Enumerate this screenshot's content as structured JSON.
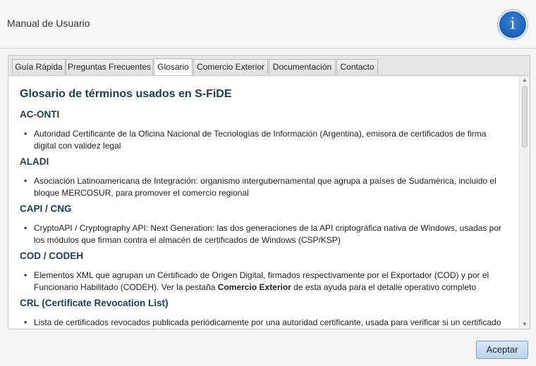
{
  "window": {
    "title": "Manual de Usuario",
    "info_icon": "i"
  },
  "tabs": [
    {
      "label": "Guía Rápida"
    },
    {
      "label": "Preguntas Frecuentes"
    },
    {
      "label": "Glosario",
      "active": true
    },
    {
      "label": "Comercio Exterior"
    },
    {
      "label": "Documentación"
    },
    {
      "label": "Contacto"
    }
  ],
  "glossary": {
    "title": "Glosario de términos usados en S-FiDE",
    "bullet": "•",
    "entries": [
      {
        "term": "AC-ONTI",
        "definition": "Autoridad Certificante de la Oficina Nacional de Tecnologías de Información (Argentina), emisora de certificados de firma digital con validez legal"
      },
      {
        "term": "ALADI",
        "definition": "Asociación Latinoamericana de Integración: organismo intergubernamental que agrupa a países de Sudamérica, incluido el bloque MERCOSUR, para promover el comercio regional"
      },
      {
        "term": "CAPI / CNG",
        "definition": "CryptoAPI / Cryptography API: Next Generation: las dos generaciones de la API criptográfica nativa de Windows, usadas por los módulos que firman contra el almacén de certificados de Windows (CSP/KSP)"
      },
      {
        "term": "COD / CODEH",
        "definition_parts": [
          "Elementos XML que agrupan un Certificado de Origen Digital, firmados respectivamente por el Exportador (COD) y por el Funcionario Habilitado (CODEH). Ver la pestaña ",
          "Comercio Exterior",
          " de esta ayuda para el detalle operativo completo"
        ]
      },
      {
        "term": "CRL (Certificate Revocation List)",
        "definition": "Lista de certificados revocados publicada periódicamente por una autoridad certificante, usada para verificar si un certificado"
      }
    ]
  },
  "footer": {
    "accept_label": "Aceptar"
  },
  "scroll": {
    "up_arrow": "▲",
    "down_arrow": "▼"
  }
}
